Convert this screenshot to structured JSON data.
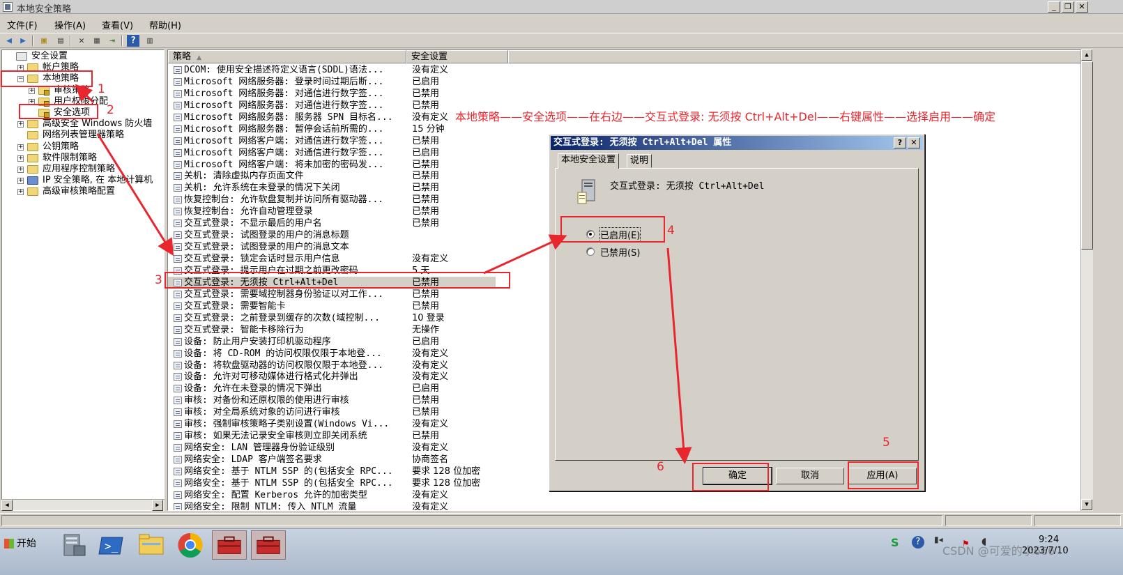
{
  "window": {
    "title": "本地安全策略"
  },
  "menu": [
    "文件(F)",
    "操作(A)",
    "查看(V)",
    "帮助(H)"
  ],
  "tree": [
    {
      "label": "安全设置",
      "indent": 0,
      "expander": "",
      "icon": "settings"
    },
    {
      "label": "帐户策略",
      "indent": 1,
      "expander": "+",
      "icon": "folder"
    },
    {
      "label": "本地策略",
      "indent": 1,
      "expander": "−",
      "icon": "folder"
    },
    {
      "label": "审核策略",
      "indent": 2,
      "expander": "+",
      "icon": "folder"
    },
    {
      "label": "用户权限分配",
      "indent": 2,
      "expander": "+",
      "icon": "folder"
    },
    {
      "label": "安全选项",
      "indent": 2,
      "expander": "",
      "icon": "folder"
    },
    {
      "label": "高级安全 Windows 防火墙",
      "indent": 1,
      "expander": "+",
      "icon": "folder"
    },
    {
      "label": "网络列表管理器策略",
      "indent": 1,
      "expander": "",
      "icon": "folder"
    },
    {
      "label": "公钥策略",
      "indent": 1,
      "expander": "+",
      "icon": "folder"
    },
    {
      "label": "软件限制策略",
      "indent": 1,
      "expander": "+",
      "icon": "folder"
    },
    {
      "label": "应用程序控制策略",
      "indent": 1,
      "expander": "+",
      "icon": "folder"
    },
    {
      "label": "IP 安全策略, 在 本地计算机",
      "indent": 1,
      "expander": "+",
      "icon": "ipsec"
    },
    {
      "label": "高级审核策略配置",
      "indent": 1,
      "expander": "+",
      "icon": "folder"
    }
  ],
  "list": {
    "columns": [
      "策略",
      "安全设置"
    ],
    "rows": [
      {
        "policy": "DCOM: 使用安全描述符定义语言(SDDL)语法...",
        "setting": "没有定义"
      },
      {
        "policy": "Microsoft 网络服务器: 登录时间过期后断...",
        "setting": "已启用"
      },
      {
        "policy": "Microsoft 网络服务器: 对通信进行数字签...",
        "setting": "已禁用"
      },
      {
        "policy": "Microsoft 网络服务器: 对通信进行数字签...",
        "setting": "已禁用"
      },
      {
        "policy": "Microsoft 网络服务器: 服务器 SPN 目标名...",
        "setting": "没有定义"
      },
      {
        "policy": "Microsoft 网络服务器: 暂停会话前所需的...",
        "setting": "15 分钟"
      },
      {
        "policy": "Microsoft 网络客户端: 对通信进行数字签...",
        "setting": "已禁用"
      },
      {
        "policy": "Microsoft 网络客户端: 对通信进行数字签...",
        "setting": "已启用"
      },
      {
        "policy": "Microsoft 网络客户端: 将未加密的密码发...",
        "setting": "已禁用"
      },
      {
        "policy": "关机: 清除虚拟内存页面文件",
        "setting": "已禁用"
      },
      {
        "policy": "关机: 允许系统在未登录的情况下关闭",
        "setting": "已禁用"
      },
      {
        "policy": "恢复控制台: 允许软盘复制并访问所有驱动器...",
        "setting": "已禁用"
      },
      {
        "policy": "恢复控制台: 允许自动管理登录",
        "setting": "已禁用"
      },
      {
        "policy": "交互式登录: 不显示最后的用户名",
        "setting": "已禁用"
      },
      {
        "policy": "交互式登录: 试图登录的用户的消息标题",
        "setting": ""
      },
      {
        "policy": "交互式登录: 试图登录的用户的消息文本",
        "setting": ""
      },
      {
        "policy": "交互式登录: 锁定会话时显示用户信息",
        "setting": "没有定义"
      },
      {
        "policy": "交互式登录: 提示用户在过期之前更改密码",
        "setting": "5 天"
      },
      {
        "policy": "交互式登录: 无须按 Ctrl+Alt+Del",
        "setting": "已禁用"
      },
      {
        "policy": "交互式登录: 需要域控制器身份验证以对工作...",
        "setting": "已禁用"
      },
      {
        "policy": "交互式登录: 需要智能卡",
        "setting": "已禁用"
      },
      {
        "policy": "交互式登录: 之前登录到缓存的次数(域控制...",
        "setting": "10 登录"
      },
      {
        "policy": "交互式登录: 智能卡移除行为",
        "setting": "无操作"
      },
      {
        "policy": "设备: 防止用户安装打印机驱动程序",
        "setting": "已启用"
      },
      {
        "policy": "设备: 将 CD-ROM 的访问权限仅限于本地登...",
        "setting": "没有定义"
      },
      {
        "policy": "设备: 将软盘驱动器的访问权限仅限于本地登...",
        "setting": "没有定义"
      },
      {
        "policy": "设备: 允许对可移动媒体进行格式化并弹出",
        "setting": "没有定义"
      },
      {
        "policy": "设备: 允许在未登录的情况下弹出",
        "setting": "已启用"
      },
      {
        "policy": "审核: 对备份和还原权限的使用进行审核",
        "setting": "已禁用"
      },
      {
        "policy": "审核: 对全局系统对象的访问进行审核",
        "setting": "已禁用"
      },
      {
        "policy": "审核: 强制审核策略子类别设置(Windows Vi...",
        "setting": "没有定义"
      },
      {
        "policy": "审核: 如果无法记录安全审核则立即关闭系统",
        "setting": "已禁用"
      },
      {
        "policy": "网络安全: LAN 管理器身份验证级别",
        "setting": "没有定义"
      },
      {
        "policy": "网络安全: LDAP 客户端签名要求",
        "setting": "协商签名"
      },
      {
        "policy": "网络安全: 基于 NTLM SSP 的(包括安全 RPC...",
        "setting": "要求 128 位加密"
      },
      {
        "policy": "网络安全: 基于 NTLM SSP 的(包括安全 RPC...",
        "setting": "要求 128 位加密"
      },
      {
        "policy": "网络安全: 配置 Kerberos 允许的加密类型",
        "setting": "没有定义"
      },
      {
        "policy": "网络安全: 限制 NTLM: 传入 NTLM 流量",
        "setting": "没有定义"
      }
    ],
    "selected_index": 18
  },
  "dialog": {
    "title": "交互式登录: 无须按 Ctrl+Alt+Del 属性",
    "tabs": [
      "本地安全设置",
      "说明"
    ],
    "policy_name": "交互式登录: 无须按 Ctrl+Alt+Del",
    "options": [
      "已启用(E)",
      "已禁用(S)"
    ],
    "selected_option": 0,
    "buttons": {
      "ok": "确定",
      "cancel": "取消",
      "apply": "应用(A)"
    },
    "help_btn": "?",
    "close_btn": "✕"
  },
  "taskbar": {
    "start": "开始",
    "clock_time": "9:24",
    "clock_date": "2023/7/10",
    "watermark": "CSDN @可爱的小666"
  },
  "annotations": {
    "instruction": "本地策略——安全选项——在右边——交互式登录: 无须按 Ctrl+Alt+Del——右键属性——选择启用——确定",
    "numbers": [
      "1",
      "2",
      "3",
      "4",
      "5",
      "6"
    ]
  },
  "colors": {
    "annotation": "#e8262d",
    "dialog_title": "#0a246a"
  }
}
